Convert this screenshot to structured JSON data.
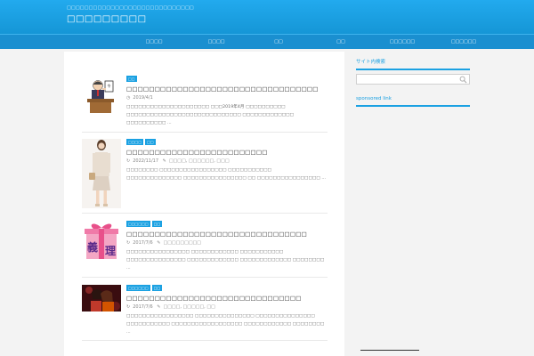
{
  "header": {
    "description": "□□□□□□□□□□□□□□□□□□□□□□□□□□□□□",
    "title": "□□□□□□□□□"
  },
  "nav": {
    "items": [
      {
        "label": "□□□□"
      },
      {
        "label": "□□□□"
      },
      {
        "label": "□□"
      },
      {
        "label": "□□"
      },
      {
        "label": "□□□□□□"
      },
      {
        "label": "□□□□□□"
      }
    ]
  },
  "posts": [
    {
      "categories": [
        "□□"
      ],
      "title": "□□□□□□□□□□□□□□□□□□□□□□□□□□□□□□□□□□",
      "date": "2019/4/1",
      "tags": "",
      "excerpt": "□□□□□□□□□□□□□□□□□□□□□ □□□2019年4月 □□□□□□□□□□ □□□□□□□□□□□□□□□□□□□□□□□□□□□□□ □□□□□□□□□□□□□ □□□□□□□□□□ …",
      "thumb": "podium-icon"
    },
    {
      "categories": [
        "□□□□",
        "□□"
      ],
      "title": "□□□□□□□□□□□□□□□□□□□□□□□□□",
      "date": "2022/11/17",
      "tags": "□□□□, □□□□□□, □□□",
      "excerpt": "□□□□□□□□ □□□□□□□□□□□□□□□□□ □□□□□□□□□□□ □□□□□□□□□□□□□□ □□□□□□□□□□□□□□□□ □□ □□□□□□□□□□□□□□□□ …",
      "thumb": "woman-icon"
    },
    {
      "categories": [
        "□□□□□□",
        "□□"
      ],
      "title": "□□□□□□□□□□□□□□□□□□□□□□□□□□□□□□□□",
      "date": "2017/7/6",
      "tags": "□□□□□□□□□",
      "excerpt": "□□□□□□□□□□□□□□□□ □□□□□□□□□□□□ □□□□□□□□□□□ □□□□□□□□□□□□□□□ □□□□□□□□□□□□□ □□□□□□□□□□□□□ □□□□□□□□ …",
      "thumb": "gift-icon"
    },
    {
      "categories": [
        "□□□□□□",
        "□□"
      ],
      "title": "□□□□□□□□□□□□□□□□□□□□□□□□□□□□□□□",
      "date": "2017/7/6",
      "tags": "□□□□, □□□□□, □□",
      "excerpt": "□□□□□□□□□□□□□□□□□ □□□□□□□□□□□□□□□ □□□□□□□□□□□□□□□ □□□□□□□□□□□ □□□□□□□□□□□□□□□□□□ □□□□□□□□□□□□ □□□□□□□□ …",
      "thumb": "couple-icon"
    }
  ],
  "sidebar": {
    "search_title": "サイト内検索",
    "search_placeholder": "",
    "sponsored_title": "sponsored link"
  },
  "colors": {
    "accent": "#1ba1e2",
    "nav": "#1a8fd0"
  }
}
